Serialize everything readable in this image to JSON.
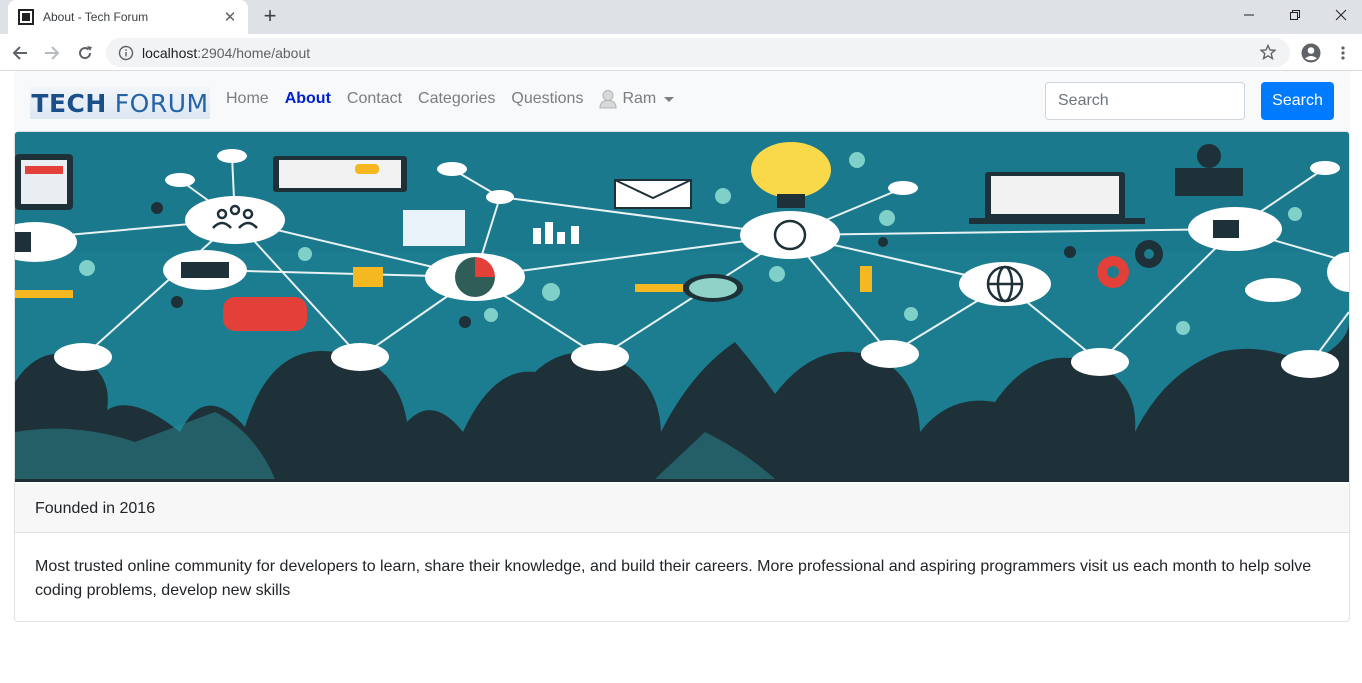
{
  "browser": {
    "tab_title": "About - Tech Forum",
    "url_host": "localhost",
    "url_path": ":2904/home/about"
  },
  "navbar": {
    "brand_part1": "TECH",
    "brand_part2": "FORUM",
    "links": [
      {
        "label": "Home",
        "active": false
      },
      {
        "label": "About",
        "active": true
      },
      {
        "label": "Contact",
        "active": false
      },
      {
        "label": "Categories",
        "active": false
      },
      {
        "label": "Questions",
        "active": false
      }
    ],
    "user_name": "Ram",
    "search_placeholder": "Search",
    "search_button": "Search"
  },
  "card": {
    "header": "Founded in 2016",
    "body": "Most trusted online community for developers to learn, share their knowledge, and build their careers. More professional and aspiring programmers visit us each month to help solve coding problems, develop new skills"
  },
  "colors": {
    "primary": "#007bff",
    "active_link": "#0022cc",
    "banner_bg": "#1b7d8f",
    "silhouette": "#1e3038"
  }
}
